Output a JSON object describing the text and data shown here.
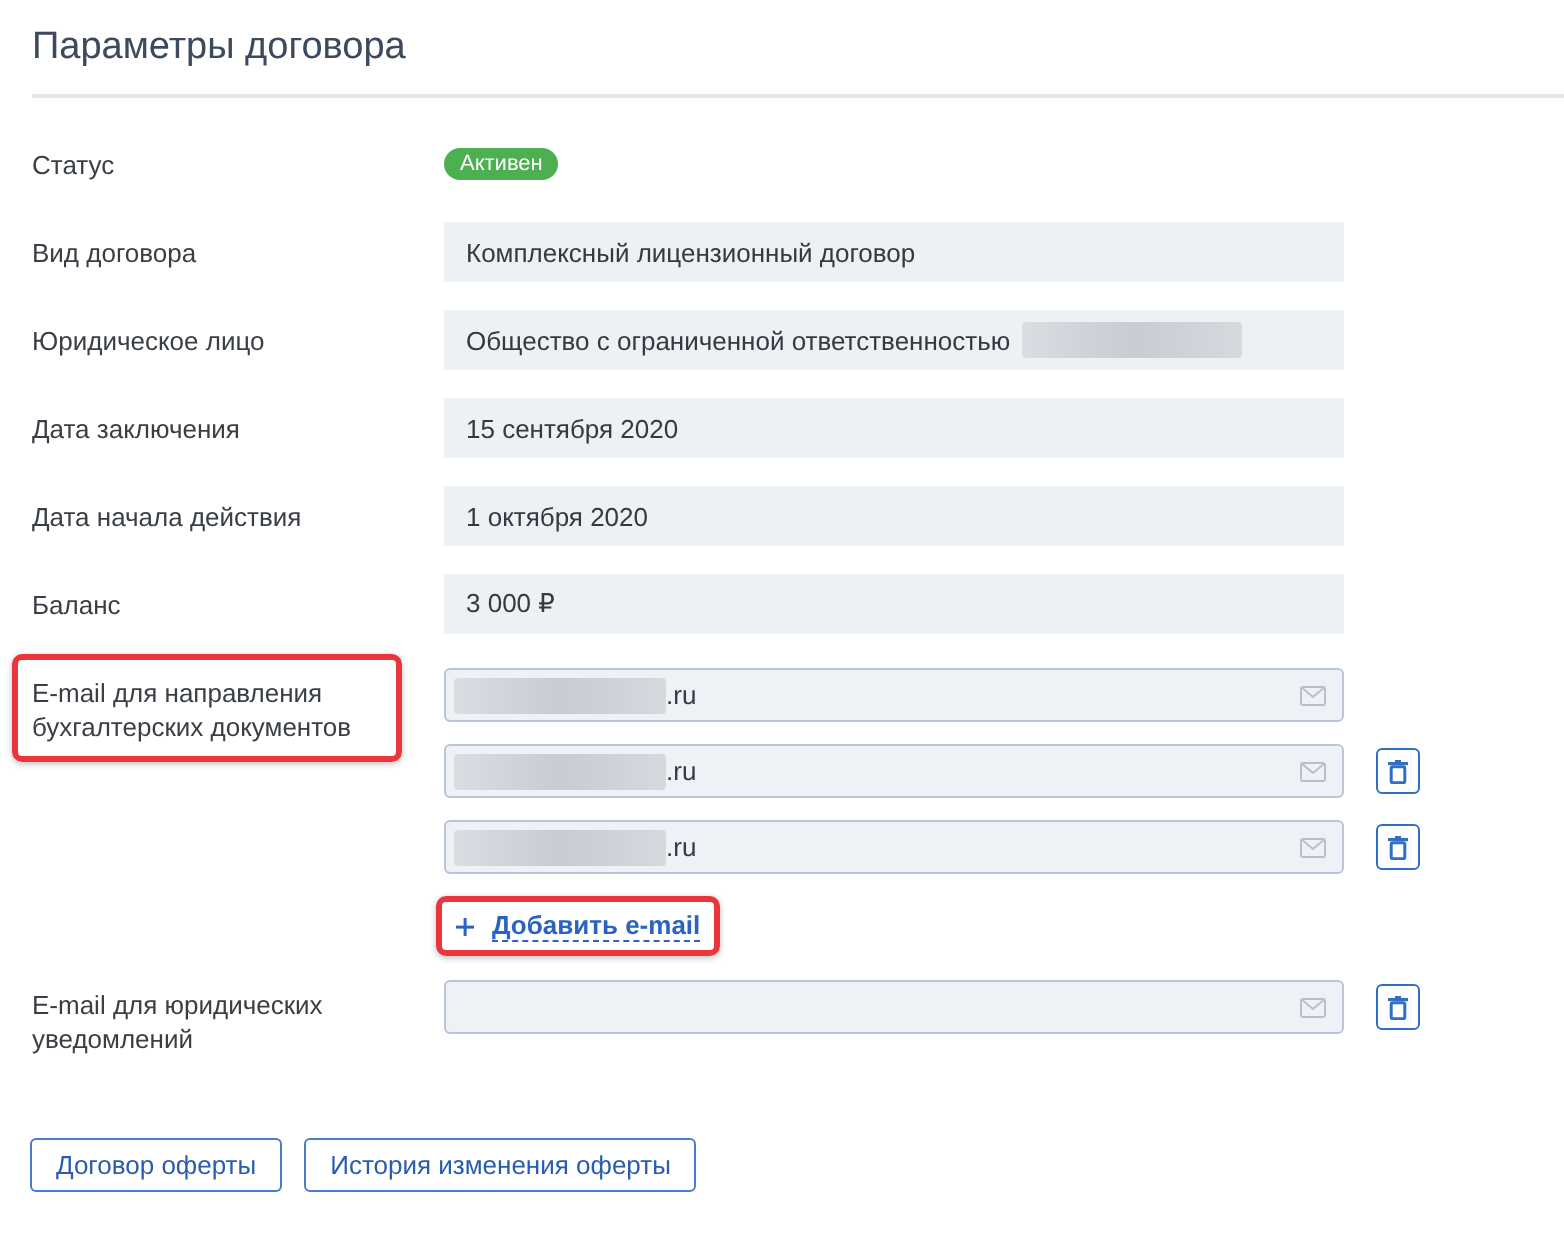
{
  "title": "Параметры договора",
  "fields": [
    {
      "kind": "badge",
      "label": "Статус",
      "value": "Активен"
    },
    {
      "kind": "text",
      "label": "Вид договора",
      "value": "Комплексный лицензионный договор",
      "redacted": false
    },
    {
      "kind": "text",
      "label": "Юридическое лицо",
      "value": "Общество с ограниченной ответственностью",
      "redacted": true
    },
    {
      "kind": "text",
      "label": "Дата заключения",
      "value": "15 сентября 2020",
      "redacted": false
    },
    {
      "kind": "text",
      "label": "Дата начала действия",
      "value": "1 октября 2020",
      "redacted": false
    },
    {
      "kind": "text",
      "label": "Баланс",
      "value": "3 000 ₽",
      "redacted": false
    },
    {
      "kind": "emails",
      "label": "E-mail для направления бухгалтерских документов",
      "highlighted": true,
      "emails": [
        {
          "value": ".ru",
          "redacted": true,
          "removable": false
        },
        {
          "value": ".ru",
          "redacted": true,
          "removable": true
        },
        {
          "value": ".ru",
          "redacted": true,
          "removable": true
        }
      ],
      "add_link": {
        "label": "Добавить e-mail",
        "highlighted": true
      }
    },
    {
      "kind": "emails",
      "label": "E-mail для юридических уведомлений",
      "highlighted": false,
      "emails": [
        {
          "redacted": false,
          "removable": true
        }
      ]
    }
  ],
  "buttons": [
    "Договор оферты",
    "История изменения оферты"
  ]
}
